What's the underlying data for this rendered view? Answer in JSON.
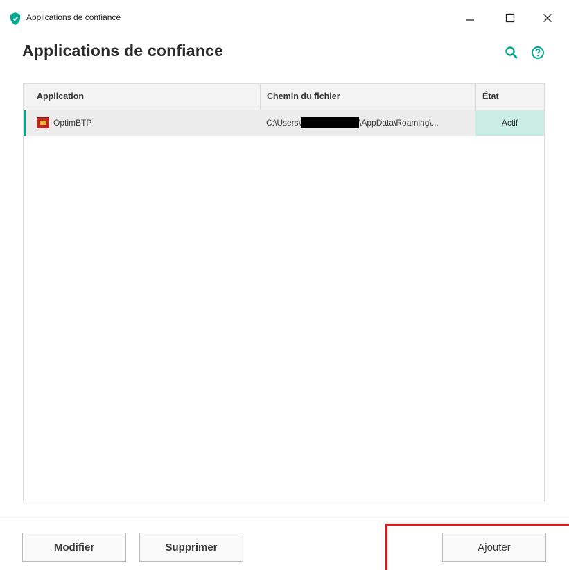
{
  "window": {
    "title": "Applications de confiance",
    "minimize_glyph": "—",
    "close_glyph": "✕"
  },
  "header": {
    "title": "Applications de confiance",
    "search_icon": "search-icon",
    "help_icon": "help-icon"
  },
  "colors": {
    "accent": "#00a88e",
    "state_bg": "#c9ede4",
    "annotation": "#e01a1a"
  },
  "table": {
    "columns": [
      "Application",
      "Chemin du fichier",
      "État"
    ],
    "rows": [
      {
        "application": "OptimBTP",
        "path_prefix": "C:\\Users\\",
        "path_suffix": "\\AppData\\Roaming\\...",
        "state": "Actif"
      }
    ]
  },
  "footer": {
    "modify_label": "Modifier",
    "delete_label": "Supprimer",
    "add_label": "Ajouter"
  }
}
